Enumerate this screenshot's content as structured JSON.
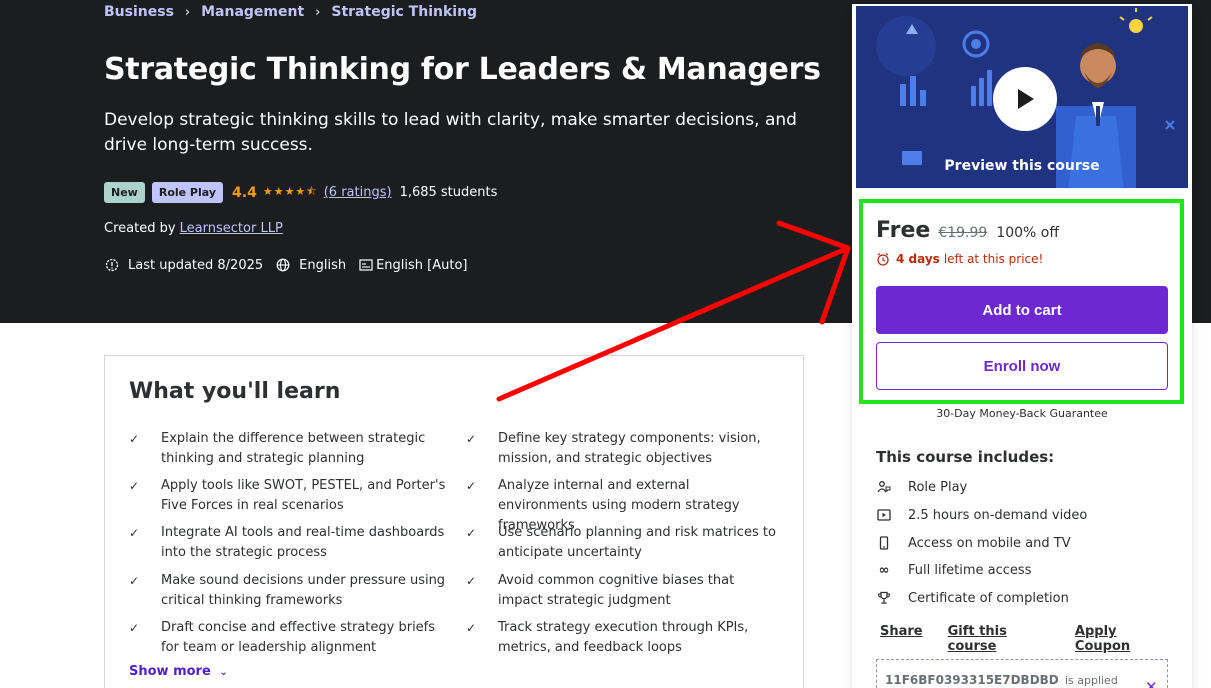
{
  "breadcrumb": {
    "items": [
      "Business",
      "Management",
      "Strategic Thinking"
    ],
    "separator": "›"
  },
  "course": {
    "title": "Strategic Thinking for Leaders & Managers",
    "subtitle": "Develop strategic thinking skills to lead with clarity, make smarter decisions, and drive long-term success.",
    "badges": [
      "New",
      "Role Play"
    ],
    "rating": "4.4",
    "stars": "★★★★⯪",
    "ratings_link": "(6 ratings)",
    "students": "1,685 students",
    "created_by_label": "Created by",
    "author": "Learnsector LLP",
    "last_updated": "Last updated 8/2025",
    "language": "English",
    "captions": "English [Auto]"
  },
  "learn": {
    "title": "What you'll learn",
    "items": [
      "Explain the difference between strategic thinking and strategic planning",
      "Define key strategy components: vision, mission, and strategic objectives",
      "Apply tools like SWOT, PESTEL, and Porter's Five Forces in real scenarios",
      "Analyze internal and external environments using modern strategy frameworks",
      "Integrate AI tools and real-time dashboards into the strategic process",
      "Use scenario planning and risk matrices to anticipate uncertainty",
      "Make sound decisions under pressure using critical thinking frameworks",
      "Avoid common cognitive biases that impact strategic judgment",
      "Draft concise and effective strategy briefs for team or leadership alignment",
      "Track strategy execution through KPIs, metrics, and feedback loops"
    ],
    "show_more": "Show more"
  },
  "sidebar": {
    "preview_label": "Preview this course",
    "price": "Free",
    "original_price": "€19.99",
    "discount": "100% off",
    "timer_bold": "4 days",
    "timer_rest": "left at this price!",
    "add_to_cart": "Add to cart",
    "enroll_now": "Enroll now",
    "guarantee": "30-Day Money-Back Guarantee",
    "includes_title": "This course includes:",
    "includes": [
      {
        "icon": "role-play-icon",
        "label": "Role Play"
      },
      {
        "icon": "video-icon",
        "label": "2.5 hours on-demand video"
      },
      {
        "icon": "mobile-icon",
        "label": "Access on mobile and TV"
      },
      {
        "icon": "infinity-icon",
        "label": "Full lifetime access"
      },
      {
        "icon": "trophy-icon",
        "label": "Certificate of completion"
      }
    ],
    "links": [
      "Share",
      "Gift this course",
      "Apply Coupon"
    ],
    "coupon_code": "11F6BF0393315E7DBDBD",
    "coupon_status": "is applied"
  },
  "colors": {
    "hero_bg": "#1c1d1f",
    "accent_purple": "#6d28d2",
    "link_lavender": "#c0c4fc",
    "star_orange": "#f69c08",
    "timer_red": "#b32d0f",
    "highlight_green": "#1ee51e",
    "annotation_red": "#ff0000"
  }
}
